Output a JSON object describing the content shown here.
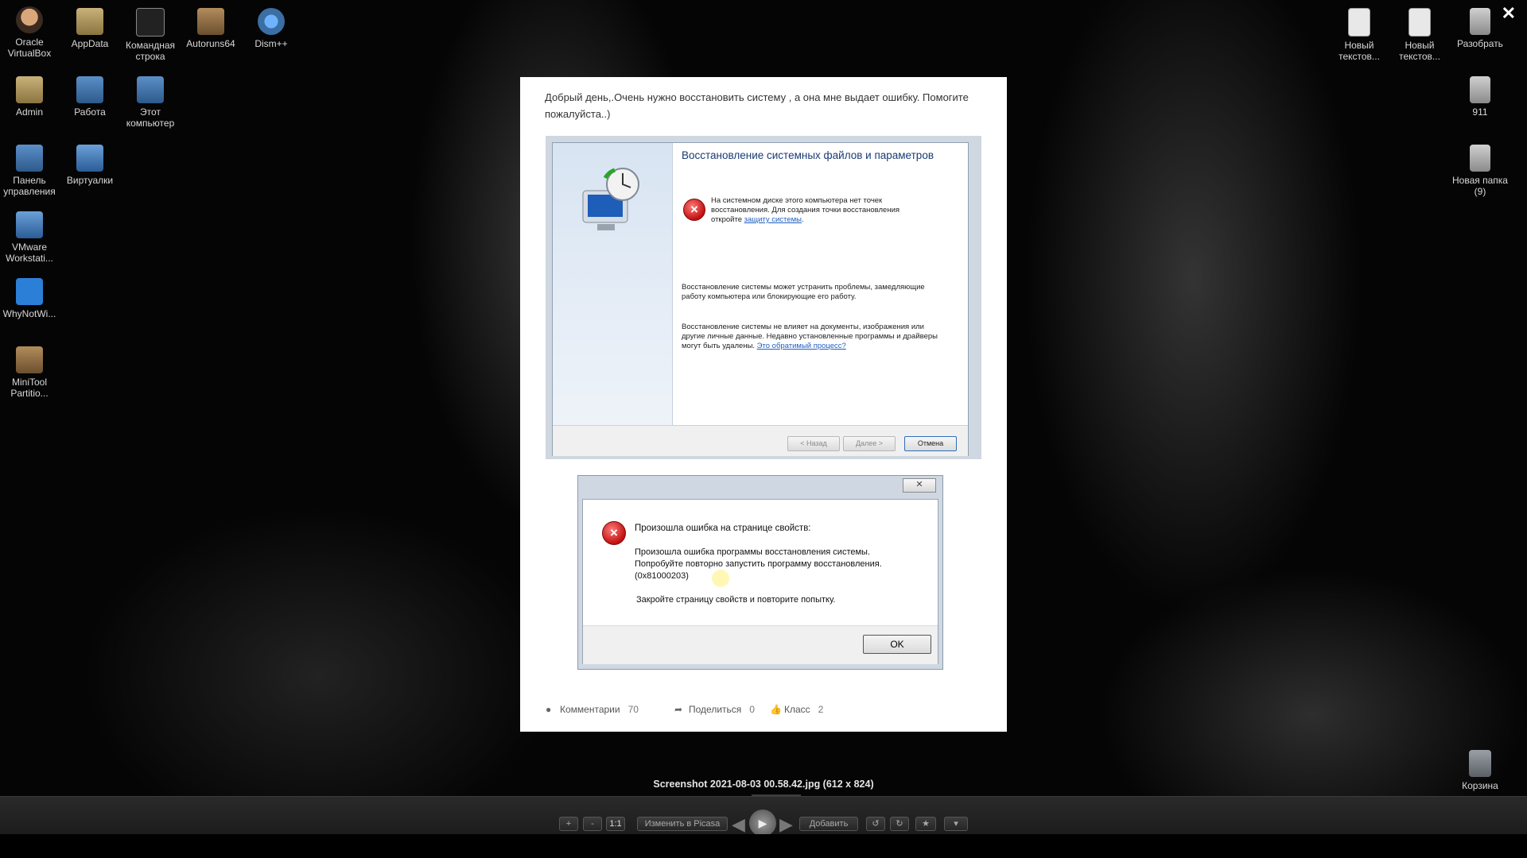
{
  "desktop": {
    "left_icons": [
      {
        "label": "Oracle VirtualBox",
        "icon": "avatar"
      },
      {
        "label": "AppData",
        "icon": "folder"
      },
      {
        "label": "Командная строка",
        "icon": "term"
      },
      {
        "label": "Autoruns64",
        "icon": "disk"
      },
      {
        "label": "Dism++",
        "icon": "gear"
      },
      {
        "label": "Admin",
        "icon": "folder"
      },
      {
        "label": "Работа",
        "icon": "pc"
      },
      {
        "label": "Этот компьютер",
        "icon": "pc"
      },
      {
        "label": "Панель управления",
        "icon": "pc"
      },
      {
        "label": "Виртуалки",
        "icon": "vm"
      },
      {
        "label": "VMware Workstati...",
        "icon": "vm"
      },
      {
        "label": "WhyNotWi...",
        "icon": "win"
      },
      {
        "label": "MiniTool Partitio...",
        "icon": "disk"
      }
    ],
    "right_icons": [
      {
        "label": "Новый текстов...",
        "icon": "doc"
      },
      {
        "label": "Новый текстов...",
        "icon": "doc"
      },
      {
        "label": "Разобрать",
        "icon": "zip"
      },
      {
        "label": "911",
        "icon": "zip"
      },
      {
        "label": "Новая папка (9)",
        "icon": "zip"
      },
      {
        "label": "Корзина",
        "icon": "bin"
      }
    ]
  },
  "viewer": {
    "close_glyph": "✕",
    "caption": "Screenshot 2021-08-03 00.58.42.jpg (612 x 824)",
    "toolbar": {
      "zoom_in": "+",
      "zoom_out": "-",
      "one_to_one": "1:1",
      "edit": "Изменить в Picasa",
      "play": "▶",
      "prev": "◀",
      "next": "▶",
      "add": "Добавить",
      "rotate_left": "↺",
      "rotate_right": "↻",
      "star": "★",
      "more": "▾"
    }
  },
  "post": {
    "text": "Добрый день,.Очень нужно восстановить систему , а она мне выдает ошибку. Помогите пожалуйста..)",
    "restore_dialog": {
      "title": "Восстановление системных файлов и параметров",
      "warning_part1": "На системном диске этого компьютера нет точек восстановления. Для создания точки восстановления откройте ",
      "warning_link": "защиту системы",
      "warning_part2": ".",
      "para1": "Восстановление системы может устранить проблемы, замедляющие работу компьютера или блокирующие его работу.",
      "para2": "Восстановление системы не влияет на документы, изображения или другие личные данные. Недавно установленные программы и драйверы могут быть удалены. ",
      "para2_link": "Это обратимый процесс?",
      "back_btn": "< Назад",
      "next_btn": "Далее >",
      "cancel_btn": "Отмена"
    },
    "error_dialog": {
      "close_glyph": "✕",
      "heading": "Произошла ошибка на странице свойств:",
      "line1": "Произошла ошибка программы восстановления системы.",
      "line2": "Попробуйте повторно запустить программу восстановления.",
      "line3": "(0x81000203)",
      "line4": "Закройте страницу свойств и повторите попытку.",
      "ok": "OK"
    },
    "actions": {
      "comments_label": "Комментарии",
      "comments_count": "70",
      "share_label": "Поделиться",
      "share_count": "0",
      "like_label": "Класс",
      "like_count": "2"
    }
  }
}
